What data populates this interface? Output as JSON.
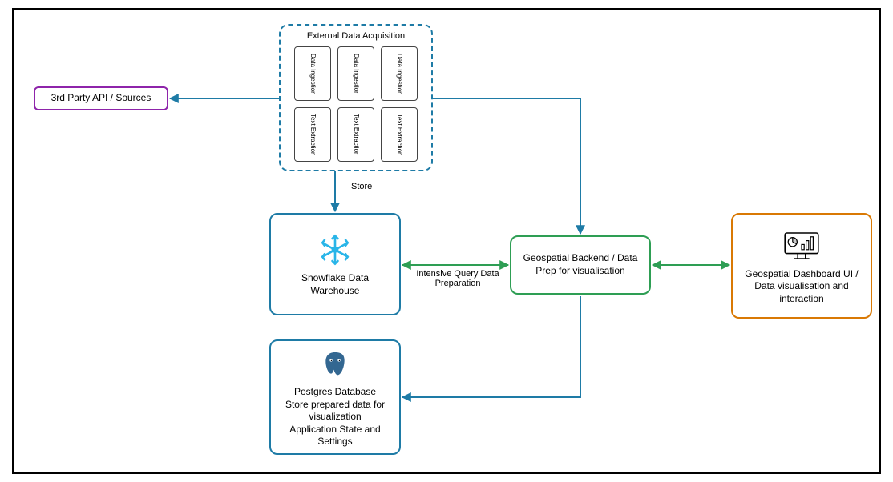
{
  "nodes": {
    "third_party": {
      "label": "3rd Party API / Sources"
    },
    "ext_acq": {
      "title": "External Data Acquisition",
      "row1": [
        "Data Ingestion",
        "Data Ingestion",
        "Data Ingestion"
      ],
      "row2": [
        "Text Extraction",
        "Text Extraction",
        "Text Extraction"
      ]
    },
    "snowflake": {
      "label": "Snowflake Data Warehouse"
    },
    "postgres": {
      "line1": "Postgres Database",
      "line2": "Store prepared data for visualization",
      "line3": "Application State and Settings"
    },
    "geo_backend": {
      "label": "Geospatial Backend / Data Prep for visualisation"
    },
    "geo_dashboard": {
      "label": "Geospatial Dashboard UI / Data visualisation and interaction"
    }
  },
  "edges": {
    "store": "Store",
    "intensive": "Intensive Query Data Preparation"
  },
  "colors": {
    "teal": "#1e7ba6",
    "green": "#2e9e54",
    "orange": "#d97904",
    "purple": "#8e24aa"
  }
}
